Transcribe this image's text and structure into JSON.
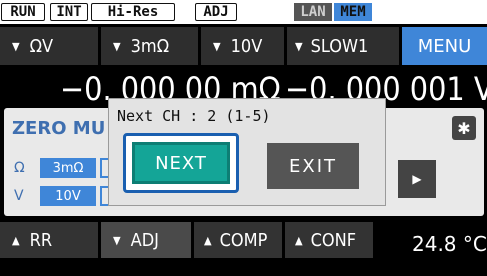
{
  "status": {
    "run": "RUN",
    "int": "INT",
    "hires": "Hi-Res",
    "adj": "ADJ",
    "lan": "LAN",
    "mem": "MEM"
  },
  "top": {
    "range_ohm": "ΩV",
    "range_res": "3mΩ",
    "range_volt": "10V",
    "speed": "SLOW1",
    "menu": "MENU"
  },
  "measure": {
    "resistance": "−0. 000 00  mΩ",
    "voltage": "−0. 000 001  V"
  },
  "zero": {
    "title": "ZERO MU",
    "row1_label": "Ω",
    "row1_value": "3mΩ",
    "row2_label": "V",
    "row2_value": "10V",
    "gear_icon": "gear-icon",
    "arrow_icon": "chevron-right-icon"
  },
  "dialog": {
    "title": "Next CH : 2 (1-5)",
    "next": "NEXT",
    "exit": "EXIT"
  },
  "bottom": {
    "rr": "RR",
    "adj": "ADJ",
    "comp": "COMP",
    "conf": "CONF",
    "temp": "24.8 °C"
  },
  "colors": {
    "accent_blue": "#3f86d8",
    "next_teal": "#14a597",
    "button_dark": "#2e2e2e"
  }
}
